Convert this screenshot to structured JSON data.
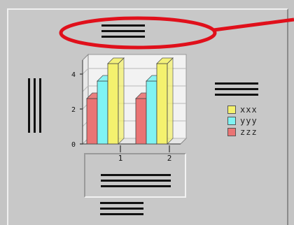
{
  "chart_data": {
    "type": "bar",
    "categories": [
      "1",
      "2"
    ],
    "series": [
      {
        "name": "xxx",
        "values": [
          4.6,
          4.6
        ],
        "color": "#f4f16e"
      },
      {
        "name": "yyy",
        "values": [
          3.6,
          3.6
        ],
        "color": "#7ff3f3"
      },
      {
        "name": "zzz",
        "values": [
          2.6,
          2.6
        ],
        "color": "#ea7474"
      }
    ],
    "ylim": [
      0,
      4.8
    ],
    "yticks": [
      "0",
      "2",
      "4"
    ],
    "grid": true,
    "legend_placement": "right"
  },
  "annotation": {
    "shape": "ellipse",
    "color": "#e0101b"
  },
  "colors": {
    "background": "#c8c8c8",
    "plot_bg": "#f2f2f2",
    "text": "#111111"
  }
}
